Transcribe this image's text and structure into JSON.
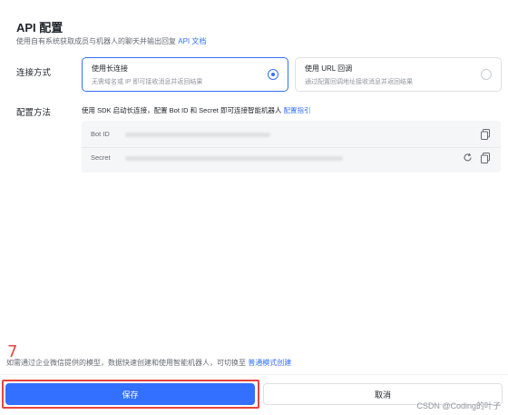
{
  "header": {
    "title": "API 配置",
    "subtitle_prefix": "使用自有系统获取成员与机器人的聊天并输出回复",
    "subtitle_link": "API 文档"
  },
  "connection": {
    "label": "连接方式",
    "options": [
      {
        "title": "使用长连接",
        "desc": "无需域名或 IP 即可接收消息并返回结果",
        "selected": true
      },
      {
        "title": "使用 URL 回调",
        "desc": "通过配置回调地址接收消息并返回结果",
        "selected": false
      }
    ]
  },
  "config": {
    "label": "配置方法",
    "desc_prefix": "使用 SDK 启动长连接，配置 Bot ID 和 Secret 即可连接智能机器人",
    "desc_link": "配置指引",
    "bot_id_label": "Bot ID",
    "secret_label": "Secret"
  },
  "note": {
    "step_number": "7",
    "text_prefix": "如需通过企业微信提供的模型，数据快速创建和使用智能机器人，可切换至",
    "link": "普通模式创建"
  },
  "footer": {
    "save_label": "保存",
    "cancel_label": "取消"
  },
  "watermark": "CSDN @Coding的叶子",
  "colors": {
    "accent": "#3370ff",
    "annotation": "#e8453c"
  }
}
